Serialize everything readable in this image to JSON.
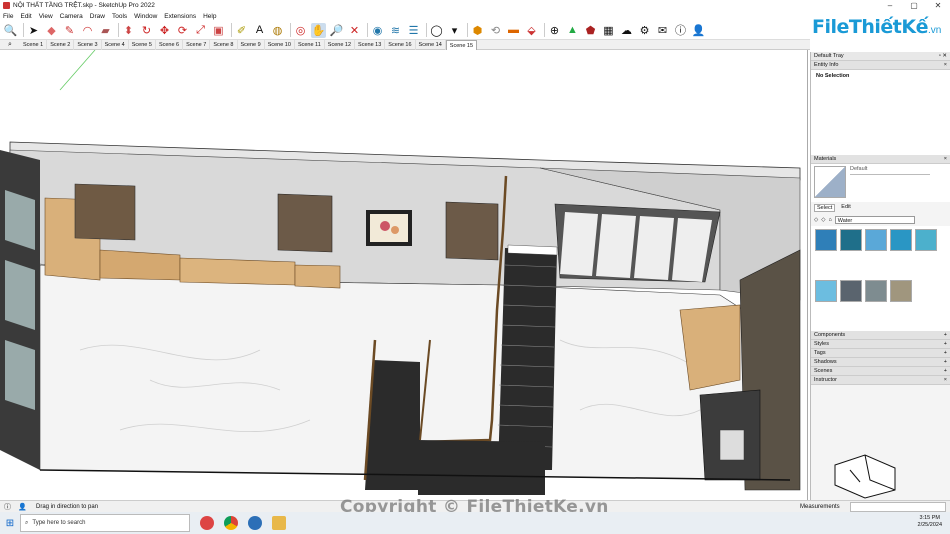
{
  "window": {
    "title": "NỘI THẤT TẦNG TRỆT.skp - SketchUp Pro 2022",
    "controls": [
      "–",
      "▢",
      "✕"
    ]
  },
  "menu": [
    "File",
    "Edit",
    "View",
    "Camera",
    "Draw",
    "Tools",
    "Window",
    "Extensions",
    "Help"
  ],
  "scenes": [
    "Scene 1",
    "Scene 2",
    "Scene 3",
    "Scene 4",
    "Scene 5",
    "Scene 6",
    "Scene 7",
    "Scene 8",
    "Scene 9",
    "Scene 10",
    "Scene 11",
    "Scene 12",
    "Scene 13",
    "Scene 16",
    "Scene 14",
    "Scene 15"
  ],
  "active_scene": "Scene 15",
  "logo": {
    "brand": "FileThiếtKế",
    "suffix": ".vn"
  },
  "tray": {
    "title": "Default Tray",
    "entity_info": "Entity Info",
    "no_selection": "No Selection",
    "materials": "Materials",
    "material_name": "Default",
    "tab_select": "Select",
    "tab_edit": "Edit",
    "collection": "Water",
    "sections": [
      "Components",
      "Styles",
      "Tags",
      "Shadows",
      "Scenes",
      "Instructor"
    ],
    "swatch_colors": [
      "#2f7fb8",
      "#1f6f8a",
      "#5aa8d8",
      "#2a96c4",
      "#4cb0cc",
      "#6cbde0",
      "#5a646e",
      "#7e8c90",
      "#a0967e"
    ]
  },
  "status": {
    "hint": "Drag in direction to pan",
    "measurements": "Measurements"
  },
  "taskbar": {
    "search_placeholder": "Type here to search",
    "time": "3:15 PM",
    "date": "2/25/2024"
  },
  "watermark": "Copyright © FileThietKe.vn"
}
